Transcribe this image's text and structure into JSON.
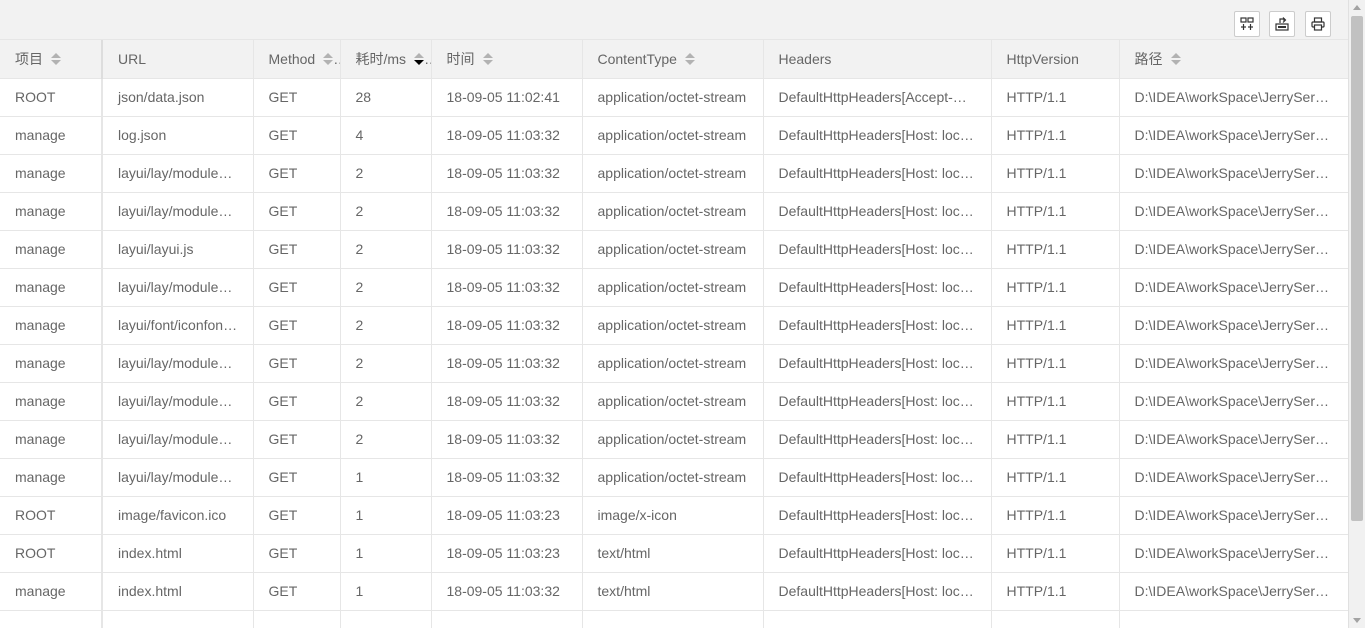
{
  "toolbar": {
    "buttons": [
      {
        "name": "columns-filter-icon"
      },
      {
        "name": "export-icon"
      },
      {
        "name": "print-icon"
      }
    ]
  },
  "table": {
    "columns": [
      {
        "key": "project",
        "label": "项目",
        "sortable": true,
        "sort": "none"
      },
      {
        "key": "url",
        "label": "URL",
        "sortable": false,
        "sort": "none"
      },
      {
        "key": "method",
        "label": "Method",
        "sortable": true,
        "sort": "none"
      },
      {
        "key": "time_ms",
        "label": "耗时/ms",
        "sortable": true,
        "sort": "desc"
      },
      {
        "key": "time",
        "label": "时间",
        "sortable": true,
        "sort": "none"
      },
      {
        "key": "content_type",
        "label": "ContentType",
        "sortable": true,
        "sort": "none"
      },
      {
        "key": "headers",
        "label": "Headers",
        "sortable": false,
        "sort": "none"
      },
      {
        "key": "http_version",
        "label": "HttpVersion",
        "sortable": false,
        "sort": "none"
      },
      {
        "key": "path",
        "label": "路径",
        "sortable": true,
        "sort": "none"
      }
    ],
    "rows": [
      [
        "ROOT",
        "json/data.json",
        "GET",
        "28",
        "18-09-05 11:02:41",
        "application/octet-stream",
        "DefaultHttpHeaders[Accept-…",
        "HTTP/1.1",
        "D:\\IDEA\\workSpace\\JerrySer…"
      ],
      [
        "manage",
        "log.json",
        "GET",
        "4",
        "18-09-05 11:03:32",
        "application/octet-stream",
        "DefaultHttpHeaders[Host: loc…",
        "HTTP/1.1",
        "D:\\IDEA\\workSpace\\JerrySer…"
      ],
      [
        "manage",
        "layui/lay/module…",
        "GET",
        "2",
        "18-09-05 11:03:32",
        "application/octet-stream",
        "DefaultHttpHeaders[Host: loc…",
        "HTTP/1.1",
        "D:\\IDEA\\workSpace\\JerrySer…"
      ],
      [
        "manage",
        "layui/lay/module…",
        "GET",
        "2",
        "18-09-05 11:03:32",
        "application/octet-stream",
        "DefaultHttpHeaders[Host: loc…",
        "HTTP/1.1",
        "D:\\IDEA\\workSpace\\JerrySer…"
      ],
      [
        "manage",
        "layui/layui.js",
        "GET",
        "2",
        "18-09-05 11:03:32",
        "application/octet-stream",
        "DefaultHttpHeaders[Host: loc…",
        "HTTP/1.1",
        "D:\\IDEA\\workSpace\\JerrySer…"
      ],
      [
        "manage",
        "layui/lay/module…",
        "GET",
        "2",
        "18-09-05 11:03:32",
        "application/octet-stream",
        "DefaultHttpHeaders[Host: loc…",
        "HTTP/1.1",
        "D:\\IDEA\\workSpace\\JerrySer…"
      ],
      [
        "manage",
        "layui/font/iconfon…",
        "GET",
        "2",
        "18-09-05 11:03:32",
        "application/octet-stream",
        "DefaultHttpHeaders[Host: loc…",
        "HTTP/1.1",
        "D:\\IDEA\\workSpace\\JerrySer…"
      ],
      [
        "manage",
        "layui/lay/module…",
        "GET",
        "2",
        "18-09-05 11:03:32",
        "application/octet-stream",
        "DefaultHttpHeaders[Host: loc…",
        "HTTP/1.1",
        "D:\\IDEA\\workSpace\\JerrySer…"
      ],
      [
        "manage",
        "layui/lay/module…",
        "GET",
        "2",
        "18-09-05 11:03:32",
        "application/octet-stream",
        "DefaultHttpHeaders[Host: loc…",
        "HTTP/1.1",
        "D:\\IDEA\\workSpace\\JerrySer…"
      ],
      [
        "manage",
        "layui/lay/module…",
        "GET",
        "2",
        "18-09-05 11:03:32",
        "application/octet-stream",
        "DefaultHttpHeaders[Host: loc…",
        "HTTP/1.1",
        "D:\\IDEA\\workSpace\\JerrySer…"
      ],
      [
        "manage",
        "layui/lay/module…",
        "GET",
        "1",
        "18-09-05 11:03:32",
        "application/octet-stream",
        "DefaultHttpHeaders[Host: loc…",
        "HTTP/1.1",
        "D:\\IDEA\\workSpace\\JerrySer…"
      ],
      [
        "ROOT",
        "image/favicon.ico",
        "GET",
        "1",
        "18-09-05 11:03:23",
        "image/x-icon",
        "DefaultHttpHeaders[Host: loc…",
        "HTTP/1.1",
        "D:\\IDEA\\workSpace\\JerrySer…"
      ],
      [
        "ROOT",
        "index.html",
        "GET",
        "1",
        "18-09-05 11:03:23",
        "text/html",
        "DefaultHttpHeaders[Host: loc…",
        "HTTP/1.1",
        "D:\\IDEA\\workSpace\\JerrySer…"
      ],
      [
        "manage",
        "index.html",
        "GET",
        "1",
        "18-09-05 11:03:32",
        "text/html",
        "DefaultHttpHeaders[Host: loc…",
        "HTTP/1.1",
        "D:\\IDEA\\workSpace\\JerrySer…"
      ],
      [
        "",
        "",
        "",
        "",
        "",
        "",
        "",
        "",
        ""
      ]
    ]
  },
  "colors": {
    "header_bg": "#f2f2f2",
    "border": "#e6e6e6",
    "text": "#666666",
    "sort_active": "#000000",
    "sort_inactive": "#b2b2b2"
  }
}
